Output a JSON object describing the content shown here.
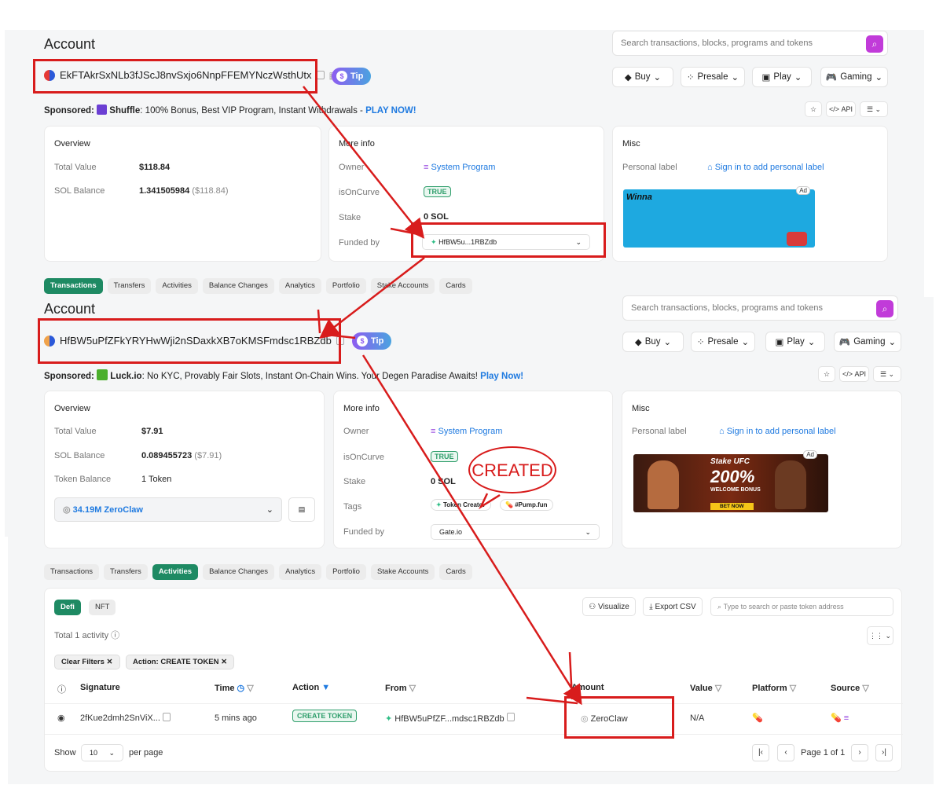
{
  "screen1": {
    "title": "Account",
    "address": "EkFTAkrSxNLb3fJScJ8nvSxjo6NnpFFEMYNczWsthUtx",
    "tip": "Tip",
    "search_placeholder": "Search transactions, blocks, programs and tokens",
    "nav": [
      "Buy",
      "Presale",
      "Play",
      "Gaming"
    ],
    "sponsored_label": "Sponsored:",
    "sponsor_name": "Shuffle",
    "sponsor_text": ": 100% Bonus, Best VIP Program, Instant Withdrawals - ",
    "sponsor_cta": "PLAY NOW!",
    "api": "API",
    "overview": {
      "title": "Overview",
      "total_value_label": "Total Value",
      "total_value": "$118.84",
      "sol_label": "SOL Balance",
      "sol_value": "1.341505984",
      "sol_usd": "($118.84)"
    },
    "more_info": {
      "title": "More info",
      "owner_label": "Owner",
      "owner_value": "System Program",
      "curve_label": "isOnCurve",
      "curve_value": "TRUE",
      "stake_label": "Stake",
      "stake_value": "0 SOL",
      "funded_label": "Funded by",
      "funded_value": "HfBW5u...1RBZdb"
    },
    "misc": {
      "title": "Misc",
      "label": "Personal label",
      "sign_in": "Sign in to add personal label",
      "ad": "Ad",
      "ad_brand": "Winna"
    },
    "tabs": [
      "Transactions",
      "Transfers",
      "Activities",
      "Balance Changes",
      "Analytics",
      "Portfolio",
      "Stake Accounts",
      "Cards"
    ]
  },
  "screen2": {
    "title": "Account",
    "address": "HfBW5uPfZFkYRYHwWji2nSDaxkXB7oKMSFmdsc1RBZdb",
    "tip": "Tip",
    "search_placeholder": "Search transactions, blocks, programs and tokens",
    "nav": [
      "Buy",
      "Presale",
      "Play",
      "Gaming"
    ],
    "sponsored_label": "Sponsored:",
    "sponsor_name": "Luck.io",
    "sponsor_text": ": No KYC, Provably Fair Slots, Instant On-Chain Wins. Your Degen Paradise Awaits! ",
    "sponsor_cta": "Play Now!",
    "api": "API",
    "overview": {
      "title": "Overview",
      "total_value_label": "Total Value",
      "total_value": "$7.91",
      "sol_label": "SOL Balance",
      "sol_value": "0.089455723",
      "sol_usd": "($7.91)",
      "token_label": "Token Balance",
      "token_value": "1 Token",
      "token_select": "34.19M ZeroClaw"
    },
    "more_info": {
      "title": "More info",
      "owner_label": "Owner",
      "owner_value": "System Program",
      "curve_label": "isOnCurve",
      "curve_value": "TRUE",
      "stake_label": "Stake",
      "stake_value": "0 SOL",
      "tags_label": "Tags",
      "tag1": "Token Creator",
      "tag2": "#Pump.fun",
      "funded_label": "Funded by",
      "funded_value": "Gate.io"
    },
    "misc": {
      "title": "Misc",
      "label": "Personal label",
      "sign_in": "Sign in to add personal label",
      "ad": "Ad",
      "ad_line1": "Stake UFC",
      "ad_line2": "200%",
      "ad_line3": "WELCOME BONUS",
      "ad_cta": "BET NOW"
    },
    "tabs": [
      "Transactions",
      "Transfers",
      "Activities",
      "Balance Changes",
      "Analytics",
      "Portfolio",
      "Stake Accounts",
      "Cards"
    ],
    "active_tab": "Activities"
  },
  "activities": {
    "subtabs": [
      "Defi",
      "NFT"
    ],
    "visualize": "Visualize",
    "export": "Export CSV",
    "token_search_placeholder": "Type to search or paste token address",
    "total": "Total 1 activity",
    "filters": [
      "Clear Filters",
      "Action: CREATE TOKEN"
    ],
    "columns": [
      "Signature",
      "Time",
      "Action",
      "From",
      "Amount",
      "Value",
      "Platform",
      "Source"
    ],
    "rows": [
      {
        "signature": "2fKue2dmh2SnViX...",
        "time": "5 mins ago",
        "action": "CREATE TOKEN",
        "from": "HfBW5uPfZF...mdsc1RBZdb",
        "amount": "ZeroClaw",
        "value": "N/A"
      }
    ],
    "show_label": "Show",
    "per_page_value": "10",
    "per_page_label": "per page",
    "page_text": "Page 1 of 1"
  },
  "annotation": {
    "created": "CREATED"
  }
}
